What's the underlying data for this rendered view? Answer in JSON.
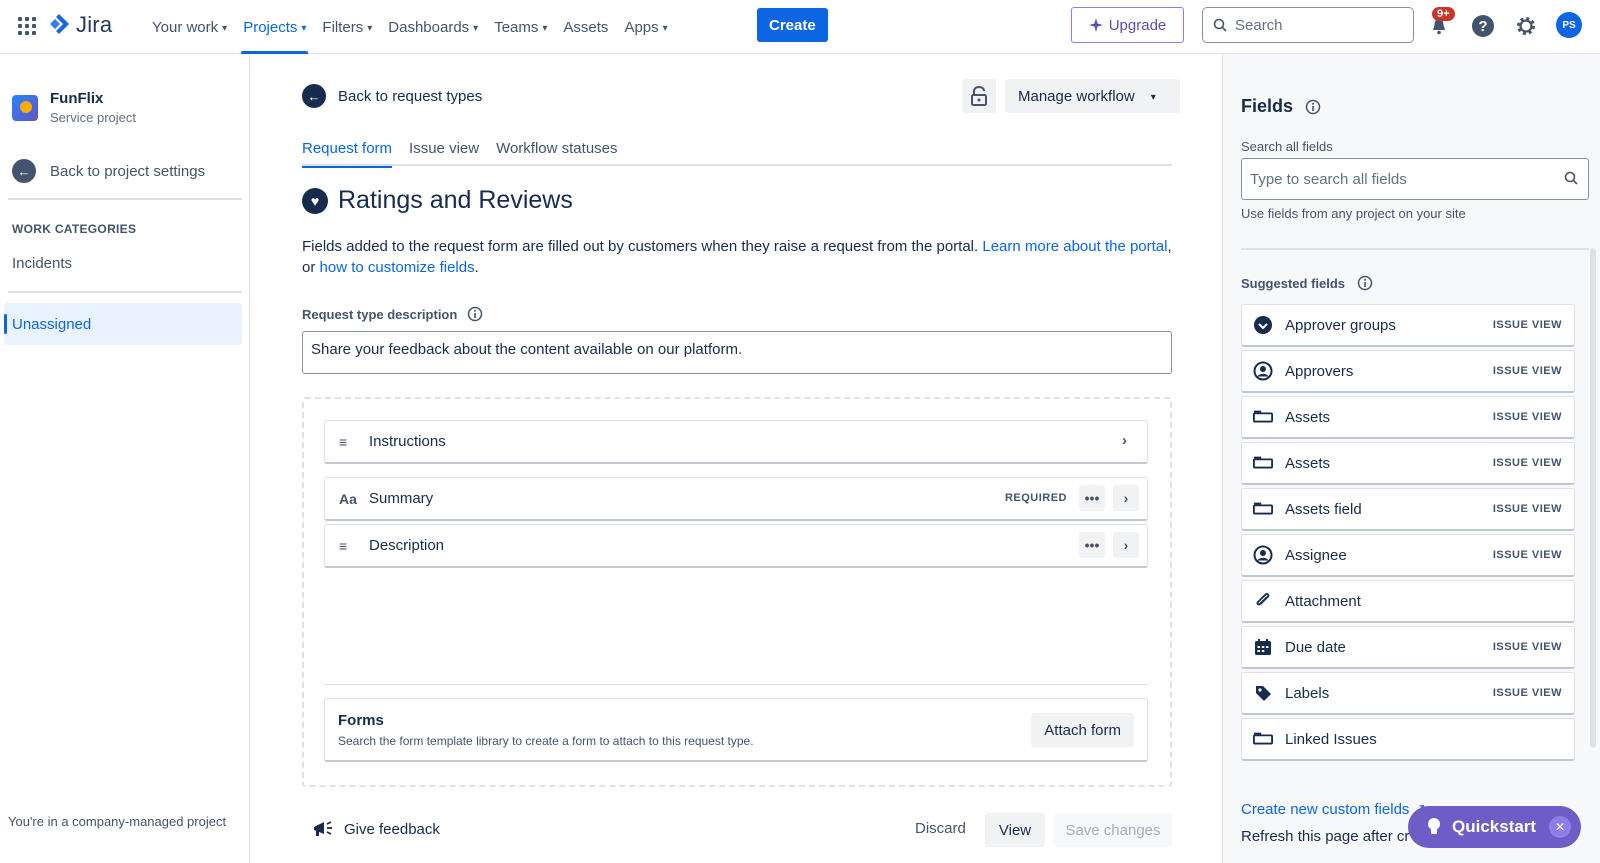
{
  "topnav": {
    "product": "Jira",
    "items": [
      {
        "label": "Your work",
        "dropdown": true
      },
      {
        "label": "Projects",
        "dropdown": true,
        "active": true
      },
      {
        "label": "Filters",
        "dropdown": true
      },
      {
        "label": "Dashboards",
        "dropdown": true
      },
      {
        "label": "Teams",
        "dropdown": true
      },
      {
        "label": "Assets",
        "dropdown": false
      },
      {
        "label": "Apps",
        "dropdown": true
      }
    ],
    "create_label": "Create",
    "upgrade_label": "Upgrade",
    "search_placeholder": "Search",
    "notifications_badge": "9+",
    "avatar_initials": "PS"
  },
  "sidebar": {
    "project_name": "FunFlix",
    "project_type": "Service project",
    "back_label": "Back to project settings",
    "work_categories_heading": "WORK CATEGORIES",
    "items": [
      {
        "label": "Incidents",
        "selected": false
      },
      {
        "label": "Unassigned",
        "selected": true
      }
    ],
    "footer": "You're in a company-managed project"
  },
  "main": {
    "back_label": "Back to request types",
    "manage_workflow_label": "Manage workflow",
    "tabs": [
      {
        "label": "Request form",
        "active": true
      },
      {
        "label": "Issue view",
        "active": false
      },
      {
        "label": "Workflow statuses",
        "active": false
      }
    ],
    "title": "Ratings and Reviews",
    "intro_text": "Fields added to the request form are filled out by customers when they raise a request from the portal. ",
    "intro_link1": "Learn more about the portal",
    "intro_mid": ", or ",
    "intro_link2": "how to customize fields",
    "intro_end": ".",
    "description_label": "Request type description",
    "description_value": "Share your feedback about the content available on our platform.",
    "form_fields": [
      {
        "label": "Instructions",
        "icon": "text-lines-icon",
        "required": false
      },
      {
        "label": "Summary",
        "icon": "text-aa-icon",
        "required": true,
        "required_label": "REQUIRED"
      },
      {
        "label": "Description",
        "icon": "text-lines-icon",
        "required": false
      }
    ],
    "forms": {
      "title": "Forms",
      "description": "Search the form template library to create a form to attach to this request type.",
      "attach_label": "Attach form"
    },
    "feedback_label": "Give feedback",
    "discard_label": "Discard",
    "view_label": "View",
    "save_label": "Save changes"
  },
  "fields_panel": {
    "title": "Fields",
    "search_label": "Search all fields",
    "search_placeholder": "Type to search all fields",
    "search_help": "Use fields from any project on your site",
    "suggested_label": "Suggested fields",
    "lozenge": "ISSUE VIEW",
    "items": [
      {
        "label": "Approver groups",
        "icon": "check-circle-icon",
        "issue_view": true
      },
      {
        "label": "Approvers",
        "icon": "person-circle-icon",
        "issue_view": true
      },
      {
        "label": "Assets",
        "icon": "field-box-icon",
        "issue_view": true
      },
      {
        "label": "Assets",
        "icon": "field-box-icon",
        "issue_view": true
      },
      {
        "label": "Assets field",
        "icon": "field-box-icon",
        "issue_view": true
      },
      {
        "label": "Assignee",
        "icon": "person-circle-icon",
        "issue_view": true
      },
      {
        "label": "Attachment",
        "icon": "paperclip-icon",
        "issue_view": false
      },
      {
        "label": "Due date",
        "icon": "calendar-icon",
        "issue_view": true
      },
      {
        "label": "Labels",
        "icon": "tag-icon",
        "issue_view": true
      },
      {
        "label": "Linked Issues",
        "icon": "field-box-icon",
        "issue_view": false
      }
    ],
    "create_custom_label": "Create new custom fields",
    "refresh_label": "Refresh this page after cr"
  },
  "quickstart": {
    "label": "Quickstart"
  },
  "colors": {
    "brand": "#0c66e4",
    "upgrade": "#5e4db2",
    "quickstart": "#6e5dc6",
    "badge": "#c9372c"
  }
}
